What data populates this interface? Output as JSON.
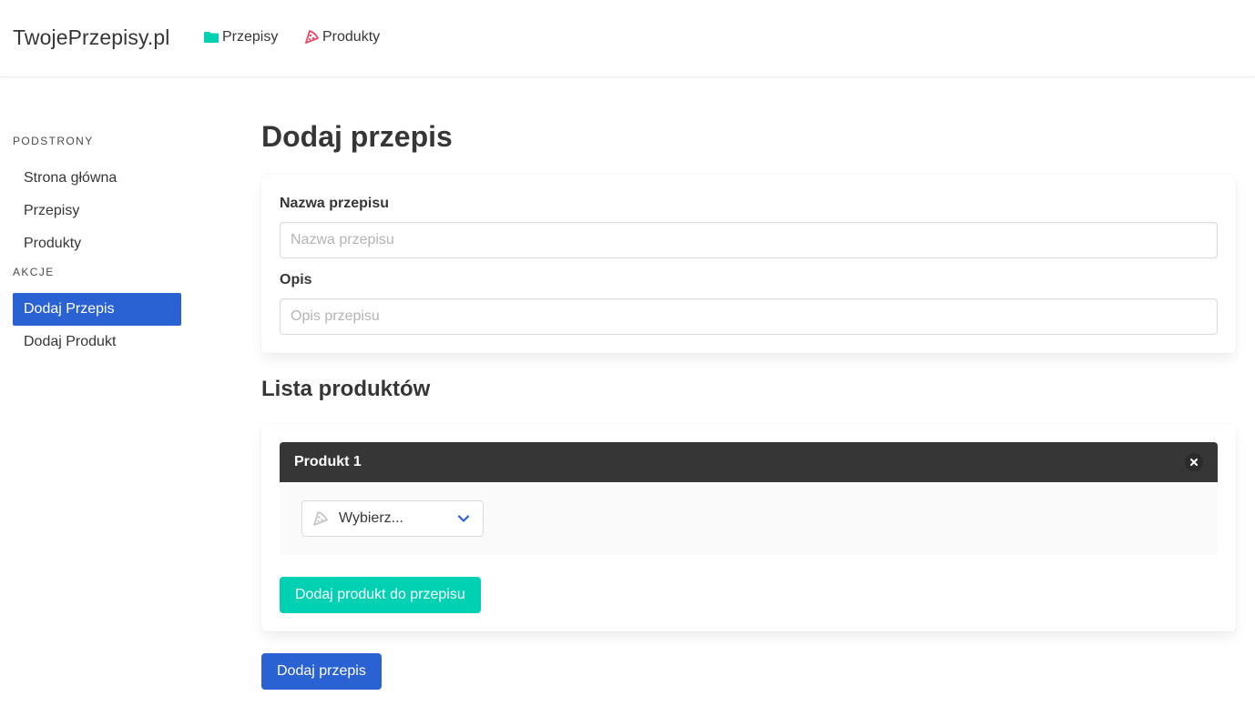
{
  "navbar": {
    "brand": "TwojePrzepisy.pl",
    "links": [
      {
        "label": "Przepisy",
        "icon": "folder-icon",
        "color": "#00d1b2"
      },
      {
        "label": "Produkty",
        "icon": "pizza-slice-icon",
        "color": "#f14668"
      }
    ]
  },
  "sidebar": {
    "sections": [
      {
        "label": "PODSTRONY",
        "items": [
          "Strona główna",
          "Przepisy",
          "Produkty"
        ]
      },
      {
        "label": "AKCJE",
        "items": [
          "Dodaj Przepis",
          "Dodaj Produkt"
        ],
        "active": "Dodaj Przepis"
      }
    ]
  },
  "form": {
    "title": "Dodaj przepis",
    "name_label": "Nazwa przepisu",
    "name_placeholder": "Nazwa przepisu",
    "name_value": "",
    "desc_label": "Opis",
    "desc_placeholder": "Opis przepisu",
    "desc_value": ""
  },
  "products": {
    "title": "Lista produktów",
    "items": [
      {
        "header": "Produkt 1",
        "select_value": "Wybierz...",
        "select_icon": "pizza-slice-icon"
      }
    ],
    "add_button": "Dodaj produkt do przepisu"
  },
  "submit_button": "Dodaj przepis",
  "colors": {
    "accent": "#2b62d3",
    "primary": "#00d1b2",
    "dark": "#363636"
  }
}
